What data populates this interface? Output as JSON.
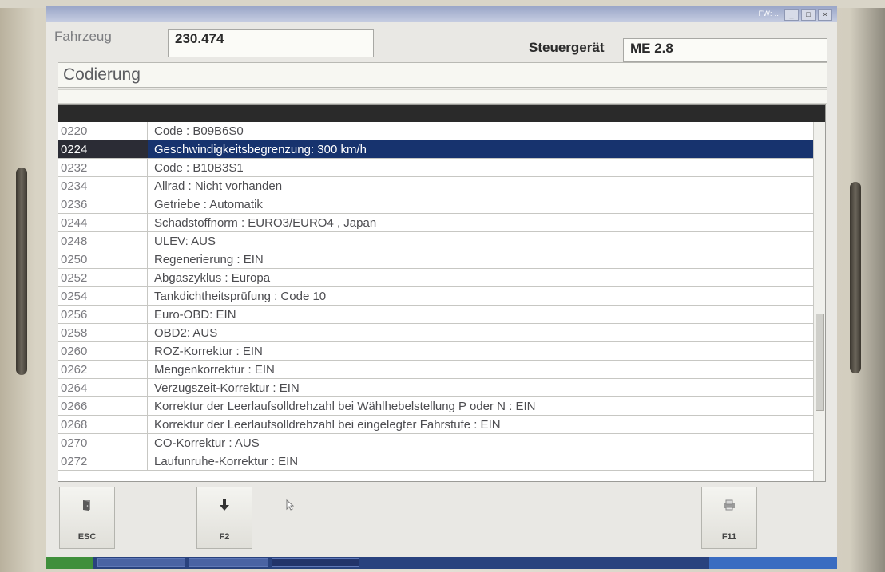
{
  "window": {
    "title": "FW: ...",
    "controls": [
      "_",
      "□",
      "×"
    ]
  },
  "header": {
    "vehicle_label": "Fahrzeug",
    "vehicle_value": "230.474",
    "ecu_label": "Steuergerät",
    "ecu_value": "ME 2.8"
  },
  "section": {
    "title": "Codierung"
  },
  "table": {
    "rows": [
      {
        "code": "0220",
        "desc": "Code : B09B6S0"
      },
      {
        "code": "0224",
        "desc": "Geschwindigkeitsbegrenzung: 300 km/h",
        "selected": true
      },
      {
        "code": "0232",
        "desc": "Code : B10B3S1"
      },
      {
        "code": "0234",
        "desc": "Allrad : Nicht vorhanden"
      },
      {
        "code": "0236",
        "desc": "Getriebe : Automatik"
      },
      {
        "code": "0244",
        "desc": "Schadstoffnorm : EURO3/EURO4 , Japan"
      },
      {
        "code": "0248",
        "desc": "ULEV: AUS"
      },
      {
        "code": "0250",
        "desc": "Regenerierung : EIN"
      },
      {
        "code": "0252",
        "desc": "Abgaszyklus : Europa"
      },
      {
        "code": "0254",
        "desc": "Tankdichtheitsprüfung : Code 10"
      },
      {
        "code": "0256",
        "desc": "Euro-OBD: EIN"
      },
      {
        "code": "0258",
        "desc": "OBD2: AUS"
      },
      {
        "code": "0260",
        "desc": "ROZ-Korrektur : EIN"
      },
      {
        "code": "0262",
        "desc": "Mengenkorrektur : EIN"
      },
      {
        "code": "0264",
        "desc": "Verzugszeit-Korrektur : EIN"
      },
      {
        "code": "0266",
        "desc": "Korrektur der Leerlaufsolldrehzahl bei Wählhebelstellung P oder N : EIN"
      },
      {
        "code": "0268",
        "desc": "Korrektur der Leerlaufsolldrehzahl bei eingelegter Fahrstufe : EIN"
      },
      {
        "code": "0270",
        "desc": "CO-Korrektur : AUS"
      },
      {
        "code": "0272",
        "desc": "Laufunruhe-Korrektur : EIN"
      }
    ]
  },
  "toolbar": {
    "esc_label": "ESC",
    "esc_icon": "exit-door-icon",
    "f2_label": "F2",
    "f2_icon": "arrow-down-icon",
    "f11_label": "F11",
    "f11_icon": "print-icon"
  },
  "colors": {
    "selection": "#17336e",
    "table_header": "#2a2a2a",
    "taskbar": "#29427e"
  }
}
